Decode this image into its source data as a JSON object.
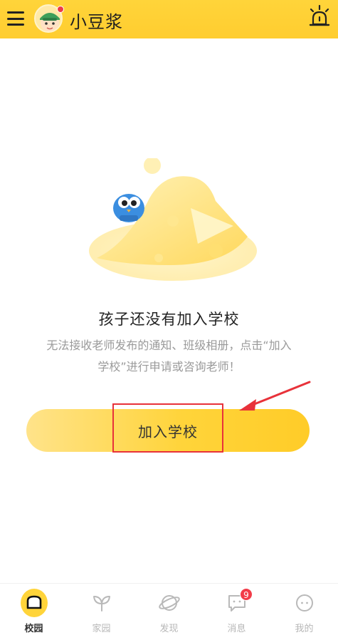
{
  "header": {
    "title": "小豆浆",
    "menu_icon": "menu-icon",
    "notification_icon": "bell-icon"
  },
  "empty_state": {
    "title": "孩子还没有加入学校",
    "description_line1": "无法接收老师发布的通知、班级相册，点击“加入",
    "description_line2": "学校”进行申请或咨询老师！",
    "join_button_label": "加入学校"
  },
  "bottom_nav": {
    "items": [
      {
        "label": "校园",
        "icon": "campus-icon",
        "active": true
      },
      {
        "label": "家园",
        "icon": "leaf-icon",
        "active": false
      },
      {
        "label": "发现",
        "icon": "planet-icon",
        "active": false
      },
      {
        "label": "消息",
        "icon": "chat-icon",
        "active": false,
        "badge": "9"
      },
      {
        "label": "我的",
        "icon": "profile-icon",
        "active": false
      }
    ]
  },
  "colors": {
    "brand_yellow": "#ffd43a",
    "annotation_red": "#e8323a",
    "badge_red": "#f23c49"
  }
}
